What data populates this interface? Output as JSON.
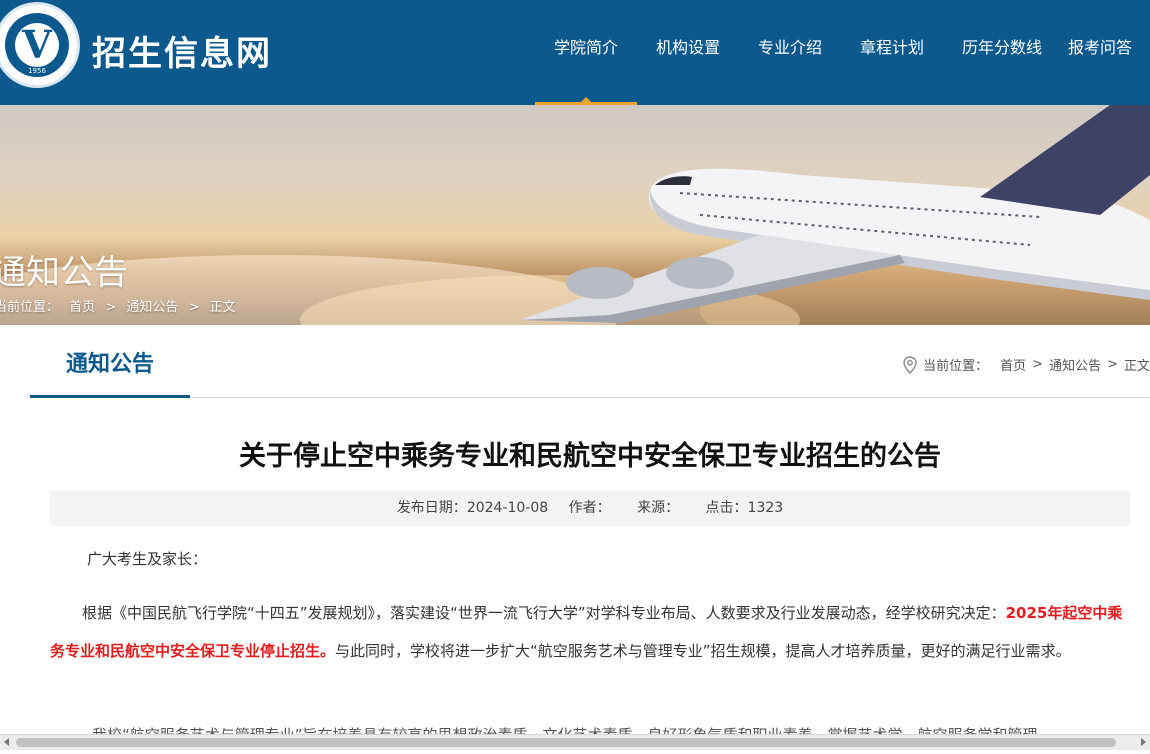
{
  "header": {
    "logo_year": "1956",
    "site_title": "招生信息网",
    "nav": [
      "学院简介",
      "机构设置",
      "专业介绍",
      "章程计划",
      "历年分数线",
      "报考问答"
    ],
    "active_index": 0
  },
  "banner": {
    "title": "通知公告",
    "breadcrumb": [
      "当前位置：",
      "首页",
      ">",
      "通知公告",
      ">",
      "正文"
    ]
  },
  "section": {
    "title": "通知公告",
    "breadcrumb": [
      "当前位置：",
      "首页",
      ">",
      "通知公告",
      ">",
      "正文"
    ]
  },
  "article": {
    "title": "关于停止空中乘务专业和民航空中安全保卫专业招生的公告",
    "meta": {
      "date_label": "发布日期：",
      "date": "2024-10-08",
      "author_label": "作者：",
      "source_label": "来源：",
      "clicks_label": "点击：",
      "clicks": "1323"
    },
    "salutation": "广大考生及家长：",
    "p2_lead": "根据《中国民航飞行学院“十四五”发展规划》，落实建设“世界一流飞行大学”对学科专业布局、人数要求及行业发展动态，经学校研究决定：",
    "p2_red": "2025年起空中乘务专业和民航空中安全保卫专业停止招生。",
    "p2_tail": "与此同时，学校将进一步扩大“航空服务艺术与管理专业”招生规模，提高人才培养质量，更好的满足行业需求。",
    "p3_partial": "我校“航空服务艺术与管理专业”旨在培养具有较高的思想政治素质、文化艺术素质，良好形象气质和职业素养，掌握艺术学、航空服务学和管理"
  },
  "icons": {
    "location": "map-pin-icon"
  },
  "colors": {
    "brand": "#0c5a8d",
    "accent": "#f2a52d",
    "highlight": "#e02020"
  }
}
